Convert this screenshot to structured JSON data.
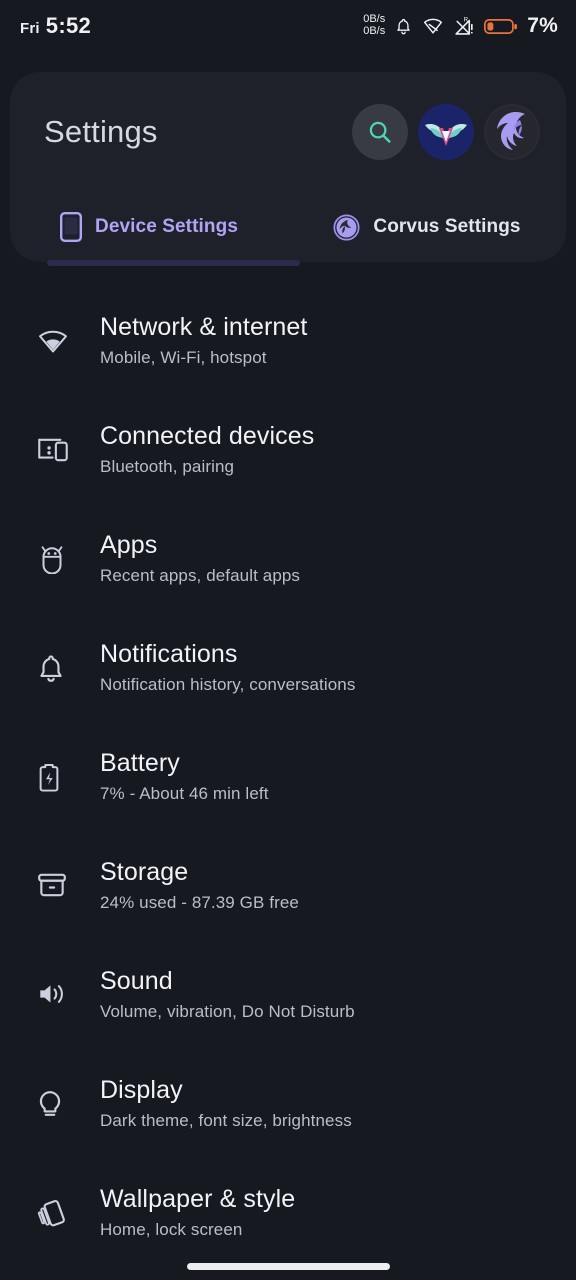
{
  "status_bar": {
    "day": "Fri",
    "time": "5:52",
    "network_speed_up": "0B/s",
    "network_speed_down": "0B/s",
    "icons": [
      "notification-bell-icon",
      "wifi-off-icon",
      "cellular-signal-roaming-icon",
      "battery-low-icon"
    ],
    "battery_percent": "7%",
    "battery_color": "#e8743c"
  },
  "header": {
    "title": "Settings",
    "search_icon": "search-icon",
    "search_icon_color": "#4fd8b0",
    "avatar_blue": "vayu-wing-logo",
    "avatar_corvus": "corvus-bird-logo"
  },
  "tabs": [
    {
      "label": "Device Settings",
      "icon": "phone-icon",
      "active": true,
      "color": "#b1a4f7"
    },
    {
      "label": "Corvus Settings",
      "icon": "corvus-bird-icon",
      "active": false,
      "color": "#e3e5ea"
    }
  ],
  "settings_items": [
    {
      "icon": "wifi-icon",
      "title": "Network & internet",
      "subtitle": "Mobile, Wi-Fi, hotspot"
    },
    {
      "icon": "connected-devices-icon",
      "title": "Connected devices",
      "subtitle": "Bluetooth, pairing"
    },
    {
      "icon": "android-apps-icon",
      "title": "Apps",
      "subtitle": "Recent apps, default apps"
    },
    {
      "icon": "bell-icon",
      "title": "Notifications",
      "subtitle": "Notification history, conversations"
    },
    {
      "icon": "battery-icon",
      "title": "Battery",
      "subtitle": "7% - About 46 min left"
    },
    {
      "icon": "storage-icon",
      "title": "Storage",
      "subtitle": "24% used - 87.39 GB free"
    },
    {
      "icon": "volume-icon",
      "title": "Sound",
      "subtitle": "Volume, vibration, Do Not Disturb"
    },
    {
      "icon": "lightbulb-icon",
      "title": "Display",
      "subtitle": "Dark theme, font size, brightness"
    },
    {
      "icon": "wallpaper-icon",
      "title": "Wallpaper & style",
      "subtitle": "Home, lock screen"
    }
  ],
  "navigation": {
    "gesture_bar": "home-gesture-bar"
  },
  "colors": {
    "page_background": "#161920",
    "card_background": "#1e2129",
    "accent": "#b1a4f7",
    "title_text": "#f2f3f7",
    "subtitle_text": "#b9bec9"
  }
}
